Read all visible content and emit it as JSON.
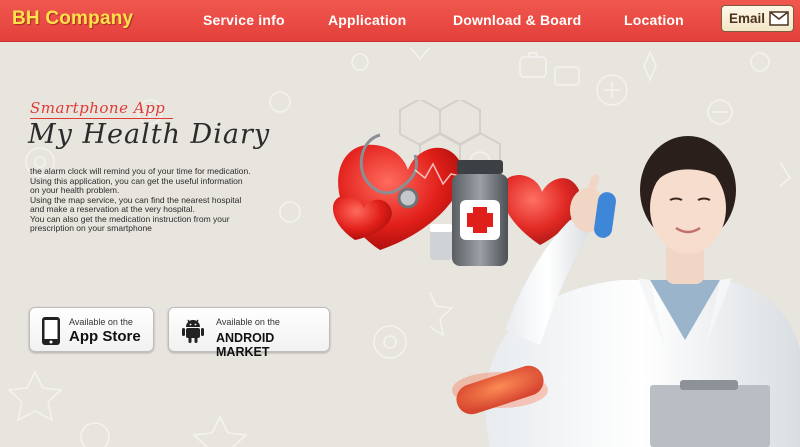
{
  "header": {
    "logo": "BH Company",
    "nav": [
      "Service info",
      "Application",
      "Download & Board",
      "Location"
    ],
    "email_label": "Email"
  },
  "hero": {
    "subtitle": "Smartphone App",
    "title": "My Health Diary",
    "description": [
      "the alarm clock will remind you of your time for medication.",
      "Using this application, you can get the useful information",
      "on your health problem.",
      "Using the map service, you can find the nearest hospital",
      "and make a reservation at the very hospital.",
      "You can also get the medication instruction from your",
      "prescription on your smartphone"
    ]
  },
  "stores": {
    "appstore": {
      "small": "Available on the",
      "big": "App Store"
    },
    "android": {
      "small": "Available on the",
      "big": "ANDROID MARKET"
    }
  },
  "icons": {
    "email": "mail-icon",
    "appstore": "phone-icon",
    "android": "android-robot-icon"
  },
  "colors": {
    "header": "#e4403b",
    "logo": "#ffe14a",
    "accent": "#e03c34",
    "background": "#e8e4de"
  }
}
